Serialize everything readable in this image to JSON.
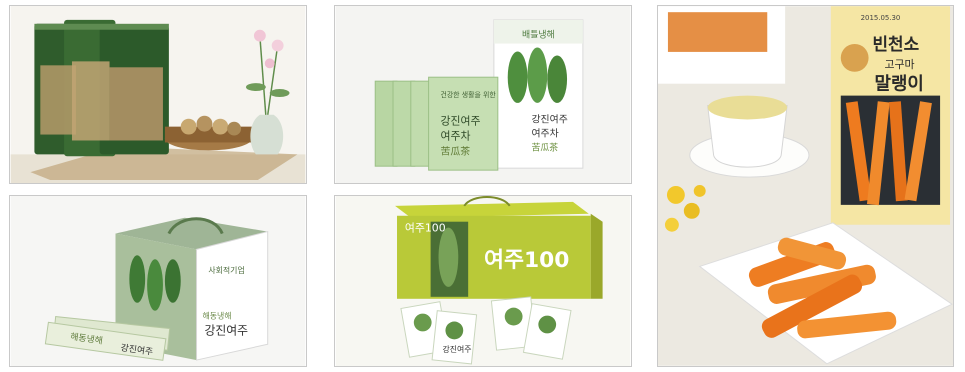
{
  "panels": [
    {
      "id": "bitter-melon-pouches"
    },
    {
      "id": "bitter-melon-tea-sachets",
      "box": {
        "top": "배틀냉해",
        "line1": "강진여주",
        "line2": "여주차",
        "mark": "苦瓜茶"
      },
      "sachet": {
        "vertical": "건강한 생활을 위한",
        "line1": "강진여주",
        "line2": "여주차",
        "mark": "苦瓜茶"
      }
    },
    {
      "id": "dried-sweet-potato",
      "bag": {
        "brand": "빈천소",
        "sub": "고구마",
        "name": "말랭이",
        "date": "2015.05.30"
      }
    },
    {
      "id": "bitter-melon-gift-box",
      "box": {
        "brand": "사회적기업",
        "label": "해동냉해",
        "name": "강진여주"
      },
      "stick": {
        "label": "해동냉해",
        "name": "강진여주"
      }
    },
    {
      "id": "bitter-melon-100",
      "box": {
        "title": "여주100",
        "title_left": "여주100"
      },
      "sachet": {
        "name": "강진여주"
      }
    }
  ]
}
